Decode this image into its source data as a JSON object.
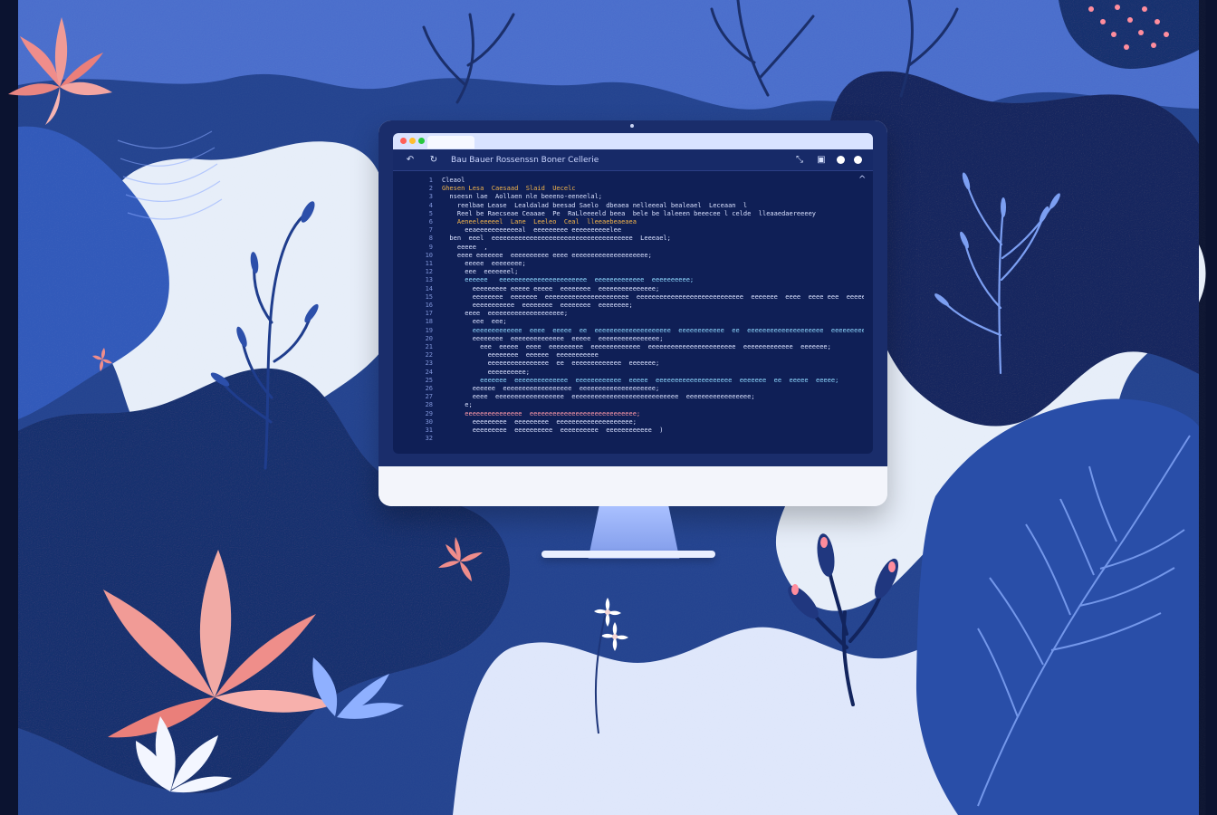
{
  "editor": {
    "toolbar_title": "Bau  Bauer  Rossenssn  Boner  Cellerie",
    "line_numbers": [
      "1",
      "2",
      "3",
      "4",
      "5",
      "6",
      "7",
      "8",
      "9",
      "10",
      "11",
      "12",
      "13",
      "14",
      "15",
      "16",
      "17",
      "18",
      "19",
      "20",
      "21",
      "22",
      "23",
      "24",
      "25",
      "26",
      "27",
      "28",
      "29",
      "30",
      "31",
      "32"
    ],
    "code_lines": [
      "Cleaol",
      "Ghesen Lesa  Caesaad  Slaid  Uecelc",
      "  nseesn lae  Aollaen nle beeeno-eeneelal;",
      "    reelbae Lease  Lealdalad beesad Saelo  dbeaea nelleeeal bealeael  Leceaan  l",
      "    Reel be Raecseae Ceaaae  Pe  RaLleeeeld beea  bele be laleeen beeecee l celde  lleaaedaereeeey",
      "    Aeneeleeeeel  Lane  Leeleo  Ceal  lleeaebeaeaea",
      "      eeaeeeeeeeeeeeal  eeeeeeeee eeeeeeeeeelee",
      "",
      "  ben  eeel  eeeeeeeeeeeeeeeeeeeeeeeeeeeeeeeeeeeee  Leeeael;",
      "    eeeee  ,",
      "    eeee eeeeeee  eeeeeeeeee eeee eeeeeeeeeeeeeeeeeeee;",
      "      eeeee  eeeeeeee;",
      "      eee  eeeeeeel;",
      "      eeeeee   eeeeeeeeeeeeeeeeeeeeeee  eeeeeeeeeeeee  eeeeeeeeee;",
      "        eeeeeeeee eeeee eeeee  eeeeeeee  eeeeeeeeeeeeeee;",
      "        eeeeeeee  eeeeeee  eeeeeeeeeeeeeeeeeeeeee  eeeeeeeeeeeeeeeeeeeeeeeeeeee  eeeeeee  eeee  eeee eee  eeeee;",
      "        eeeeeeeeeee  eeeeeeee  eeeeeeee  eeeeeeee;",
      "      eeee  eeeeeeeeeeeeeeeeeeee;",
      "        eee  eee;",
      "        eeeeeeeeeeeee  eeee  eeeee  ee  eeeeeeeeeeeeeeeeeeee  eeeeeeeeeeee  ee  eeeeeeeeeeeeeeeeeeee  eeeeeeeee;",
      "        eeeeeeee  eeeeeeeeeeeeee  eeeee  eeeeeeeeeeeeeeee;",
      "          eee  eeeee  eeee  eeeeeeeee  eeeeeeeeeeeee  eeeeeeeeeeeeeeeeeeeeeee  eeeeeeeeeeeee  eeeeeee;",
      "            eeeeeeee  eeeeee  eeeeeeeeeee",
      "            eeeeeeeeeeeeeeee  ee  eeeeeeeeeeeee  eeeeeee;",
      "            eeeeeeeeee;",
      "          eeeeeee  eeeeeeeeeeeeee  eeeeeeeeeeee  eeeee  eeeeeeeeeeeeeeeeeeee  eeeeeee  ee  eeeee  eeeee;",
      "        eeeeee  eeeeeeeeeeeeeeeeee  eeeeeeeeeeeeeeeeeeee;",
      "        eeee  eeeeeeeeeeeeeeeeee  eeeeeeeeeeeeeeeeeeeeeeeeeeee  eeeeeeeeeeeeeeeee;",
      "      e;",
      "      eeeeeeeeeeeeeee  eeeeeeeeeeeeeeeeeeeeeeeeeeee;",
      "        eeeeeeeee  eeeeeeeee  eeeeeeeeeeeeeeeeeeee;",
      "        eeeeeeeee  eeeeeeeeee  eeeeeeeeee  eeeeeeeeeeee  )"
    ]
  },
  "icons": [
    "back-icon",
    "refresh-icon",
    "collapse-icon",
    "window-icon",
    "status-dot-icon",
    "scroll-up-icon"
  ],
  "colors": {
    "deep_navy": "#0b1330",
    "royal_blue": "#2f4ea3",
    "sky_blue": "#7f9ae9",
    "pale_sky": "#dfe7fb",
    "coral": "#ea7f7a"
  }
}
